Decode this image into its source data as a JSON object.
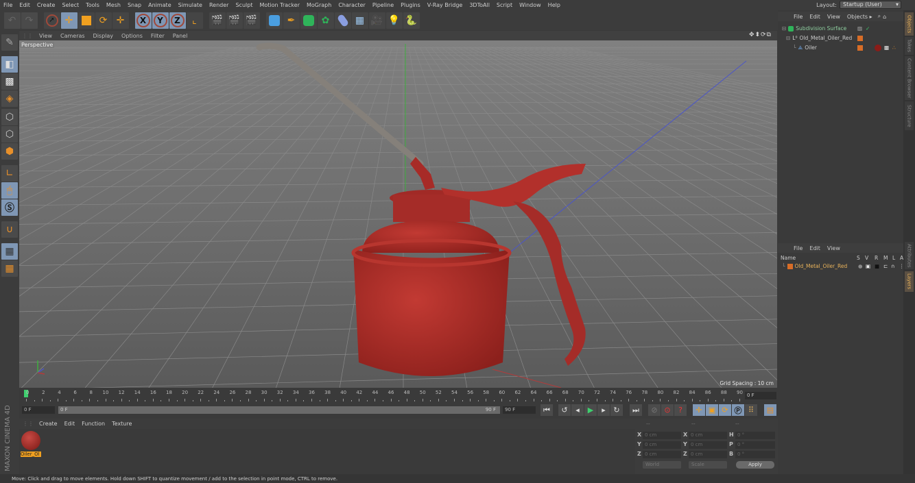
{
  "menubar": {
    "items": [
      "File",
      "Edit",
      "Create",
      "Select",
      "Tools",
      "Mesh",
      "Snap",
      "Animate",
      "Simulate",
      "Render",
      "Sculpt",
      "Motion Tracker",
      "MoGraph",
      "Character",
      "Pipeline",
      "Plugins",
      "V-Ray Bridge",
      "3DToAll",
      "Script",
      "Window",
      "Help"
    ],
    "layout_label": "Layout:",
    "layout_value": "Startup (User)"
  },
  "toolbar": {
    "icons": [
      "undo-icon",
      "redo-icon",
      "live-selection-icon",
      "move-icon",
      "scale-icon",
      "rotate-icon",
      "recent-tool-icon",
      "x-axis-lock-icon",
      "y-axis-lock-icon",
      "z-axis-lock-icon",
      "coordinate-system-icon",
      "render-view-icon",
      "render-picture-viewer-icon",
      "render-settings-icon",
      "cube-primitive-icon",
      "pen-spline-icon",
      "subdivision-surface-icon",
      "cloner-icon",
      "deformer-icon",
      "floor-environment-icon",
      "camera-icon",
      "light-icon",
      "python-icon"
    ],
    "axis_labels": [
      "X",
      "Y",
      "Z"
    ]
  },
  "left_tools": [
    "make-editable-icon",
    "texture-mode-icon",
    "workplane-icon",
    "points-mode-icon",
    "edges-mode-icon",
    "polygons-mode-icon",
    "axis-mode-icon",
    "tweak-mode-icon",
    "snap-icon",
    "magnet-icon",
    "workplane-lock-icon",
    "workplane-align-icon"
  ],
  "viewport": {
    "menu": [
      "View",
      "Cameras",
      "Display",
      "Options",
      "Filter",
      "Panel"
    ],
    "nav_icons": "✥⬍⟳⧉",
    "camera_label": "Perspective",
    "grid_spacing": "Grid Spacing : 10 cm",
    "object_color": "#b2302b",
    "spout_color": "#8a8580"
  },
  "timeline": {
    "ticks": [
      0,
      2,
      4,
      6,
      8,
      10,
      12,
      14,
      16,
      18,
      20,
      22,
      24,
      26,
      28,
      30,
      32,
      34,
      36,
      38,
      40,
      42,
      44,
      46,
      48,
      50,
      52,
      54,
      56,
      58,
      60,
      62,
      64,
      66,
      68,
      70,
      72,
      74,
      76,
      78,
      80,
      82,
      84,
      86,
      88,
      90
    ],
    "current_frame": "0 F",
    "start_field": "0 F",
    "range_start": "0 F",
    "range_end": "90 F",
    "end_field": "90 F",
    "playhead_color": "#3ecf6e"
  },
  "playback": {
    "buttons": [
      "go-to-start",
      "previous-key",
      "previous-frame",
      "play-forward",
      "next-frame",
      "next-key",
      "go-to-end",
      "record-disabled",
      "autokey",
      "keyframe-selection",
      "key-position",
      "key-scale",
      "key-rotation",
      "key-parameter",
      "key-pla",
      "timeline-layout"
    ]
  },
  "material_manager": {
    "menu": [
      "Create",
      "Edit",
      "Function",
      "Texture"
    ],
    "materials": [
      {
        "name": "Oiler_Ol"
      }
    ]
  },
  "coordinates": {
    "header": [
      "--",
      "--",
      "--"
    ],
    "rows": [
      {
        "l1": "X",
        "v1": "0 cm",
        "l2": "X",
        "v2": "0 cm",
        "l3": "H",
        "v3": "0 °"
      },
      {
        "l1": "Y",
        "v1": "0 cm",
        "l2": "Y",
        "v2": "0 cm",
        "l3": "P",
        "v3": "0 °"
      },
      {
        "l1": "Z",
        "v1": "0 cm",
        "l2": "Z",
        "v2": "0 cm",
        "l3": "B",
        "v3": "0 °"
      }
    ],
    "mode": "World",
    "size_mode": "Scale",
    "apply": "Apply"
  },
  "object_manager": {
    "menu": [
      "File",
      "Edit",
      "View",
      "Objects ▸"
    ],
    "objects": [
      {
        "name": "Subdivision Surface",
        "indent": 0,
        "icon": "subdivision-surface-icon"
      },
      {
        "name": "Old_Metal_Oiler_Red",
        "indent": 1,
        "icon": "null-object-icon"
      },
      {
        "name": "Oiler",
        "indent": 2,
        "icon": "polygon-object-icon"
      }
    ]
  },
  "layer_manager": {
    "menu": [
      "File",
      "Edit",
      "View"
    ],
    "columns": [
      "Name",
      "S",
      "V",
      "R",
      "M",
      "L",
      "A"
    ],
    "layers": [
      {
        "name": "Old_Metal_Oiler_Red",
        "color": "#d86d27"
      }
    ]
  },
  "right_tabs_top": [
    "Objects",
    "Takes",
    "Content Browser",
    "Structure"
  ],
  "right_tabs_bottom": [
    "Attributes",
    "Layers"
  ],
  "branding": "MAXON CINEMA 4D",
  "status": "Move: Click and drag to move elements. Hold down SHIFT to quantize movement / add to the selection in point mode, CTRL to remove."
}
